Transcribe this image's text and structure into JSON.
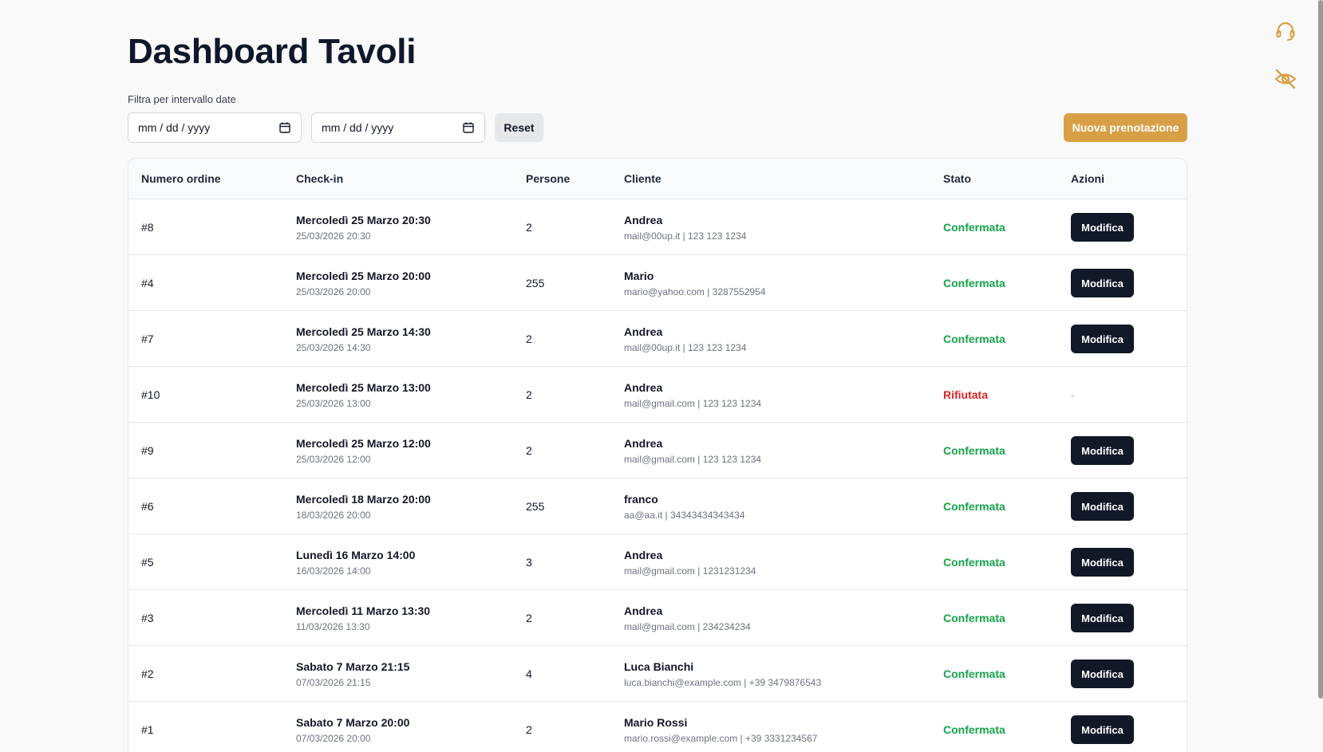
{
  "header": {
    "title": "Dashboard Tavoli"
  },
  "filter": {
    "label": "Filtra per intervallo date",
    "from_placeholder": "mm / dd / yyyy",
    "to_placeholder": "mm / dd / yyyy",
    "reset_label": "Reset",
    "new_booking_label": "Nuova prenotazione"
  },
  "side_icons": [
    "headset-icon",
    "eye-off-icon"
  ],
  "colors": {
    "accent": "#d8a046",
    "confirmed": "#16a34a",
    "rejected": "#dc2626",
    "dark_button": "#111827"
  },
  "table": {
    "columns": [
      "Numero ordine",
      "Check-in",
      "Persone",
      "Cliente",
      "Stato",
      "Azioni"
    ],
    "action_label": "Modifica",
    "no_action": "-",
    "rows": [
      {
        "order": "#8",
        "checkin": "Mercoledì 25 Marzo 20:30",
        "checkin_sub": "25/03/2026 20:30",
        "people": "2",
        "client": "Andrea",
        "client_sub": "mail@00up.it | 123 123 1234",
        "status": "Confermata",
        "status_type": "ok"
      },
      {
        "order": "#4",
        "checkin": "Mercoledì 25 Marzo 20:00",
        "checkin_sub": "25/03/2026 20:00",
        "people": "255",
        "client": "Mario",
        "client_sub": "mario@yahoo.com | 3287552954",
        "status": "Confermata",
        "status_type": "ok"
      },
      {
        "order": "#7",
        "checkin": "Mercoledì 25 Marzo 14:30",
        "checkin_sub": "25/03/2026 14:30",
        "people": "2",
        "client": "Andrea",
        "client_sub": "mail@00up.it | 123 123 1234",
        "status": "Confermata",
        "status_type": "ok"
      },
      {
        "order": "#10",
        "checkin": "Mercoledì 25 Marzo 13:00",
        "checkin_sub": "25/03/2026 13:00",
        "people": "2",
        "client": "Andrea",
        "client_sub": "mail@gmail.com | 123 123 1234",
        "status": "Rifiutata",
        "status_type": "no"
      },
      {
        "order": "#9",
        "checkin": "Mercoledì 25 Marzo 12:00",
        "checkin_sub": "25/03/2026 12:00",
        "people": "2",
        "client": "Andrea",
        "client_sub": "mail@gmail.com | 123 123 1234",
        "status": "Confermata",
        "status_type": "ok"
      },
      {
        "order": "#6",
        "checkin": "Mercoledì 18 Marzo 20:00",
        "checkin_sub": "18/03/2026 20:00",
        "people": "255",
        "client": "franco",
        "client_sub": "aa@aa.it | 34343434343434",
        "status": "Confermata",
        "status_type": "ok"
      },
      {
        "order": "#5",
        "checkin": "Lunedì 16 Marzo 14:00",
        "checkin_sub": "16/03/2026 14:00",
        "people": "3",
        "client": "Andrea",
        "client_sub": "mail@gmail.com | 1231231234",
        "status": "Confermata",
        "status_type": "ok"
      },
      {
        "order": "#3",
        "checkin": "Mercoledì 11 Marzo 13:30",
        "checkin_sub": "11/03/2026 13:30",
        "people": "2",
        "client": "Andrea",
        "client_sub": "mail@gmail.com | 234234234",
        "status": "Confermata",
        "status_type": "ok"
      },
      {
        "order": "#2",
        "checkin": "Sabato 7 Marzo 21:15",
        "checkin_sub": "07/03/2026 21:15",
        "people": "4",
        "client": "Luca Bianchi",
        "client_sub": "luca.bianchi@example.com | +39 3479876543",
        "status": "Confermata",
        "status_type": "ok"
      },
      {
        "order": "#1",
        "checkin": "Sabato 7 Marzo 20:00",
        "checkin_sub": "07/03/2026 20:00",
        "people": "2",
        "client": "Mario Rossi",
        "client_sub": "mario.rossi@example.com | +39 3331234567",
        "status": "Confermata",
        "status_type": "ok"
      }
    ]
  }
}
